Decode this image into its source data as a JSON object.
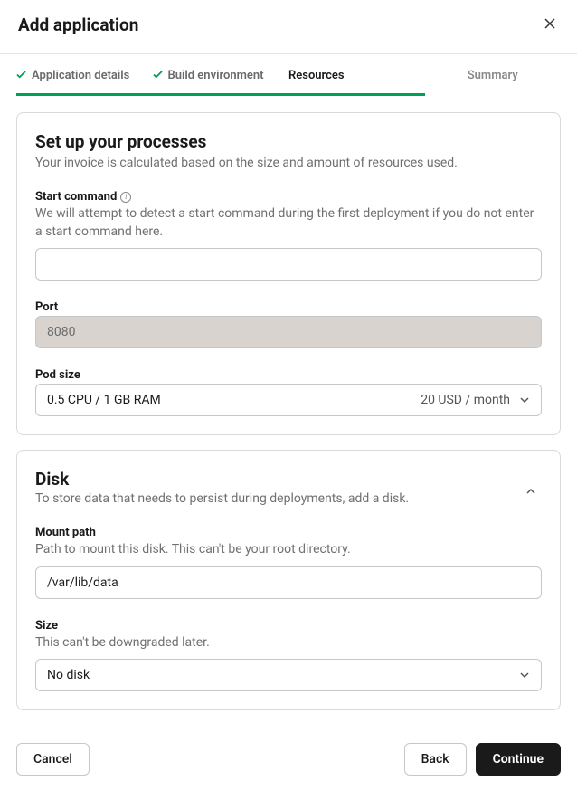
{
  "modal": {
    "title": "Add application"
  },
  "stepper": {
    "steps": [
      {
        "label": "Application details",
        "state": "completed"
      },
      {
        "label": "Build environment",
        "state": "completed"
      },
      {
        "label": "Resources",
        "state": "active"
      },
      {
        "label": "Summary",
        "state": "upcoming"
      }
    ]
  },
  "processes": {
    "heading": "Set up your processes",
    "subtitle": "Your invoice is calculated based on the size and amount of resources used.",
    "start_command": {
      "label": "Start command",
      "help": "We will attempt to detect a start command during the first deployment if you do not enter a start command here.",
      "value": ""
    },
    "port": {
      "label": "Port",
      "value": "8080"
    },
    "pod_size": {
      "label": "Pod size",
      "selected": "0.5 CPU / 1 GB RAM",
      "price": "20 USD / month"
    }
  },
  "disk": {
    "heading": "Disk",
    "subtitle": "To store data that needs to persist during deployments, add a disk.",
    "mount_path": {
      "label": "Mount path",
      "help": "Path to mount this disk. This can't be your root directory.",
      "value": "/var/lib/data"
    },
    "size": {
      "label": "Size",
      "help": "This can't be downgraded later.",
      "selected": "No disk"
    }
  },
  "footer": {
    "cancel": "Cancel",
    "back": "Back",
    "continue": "Continue"
  }
}
